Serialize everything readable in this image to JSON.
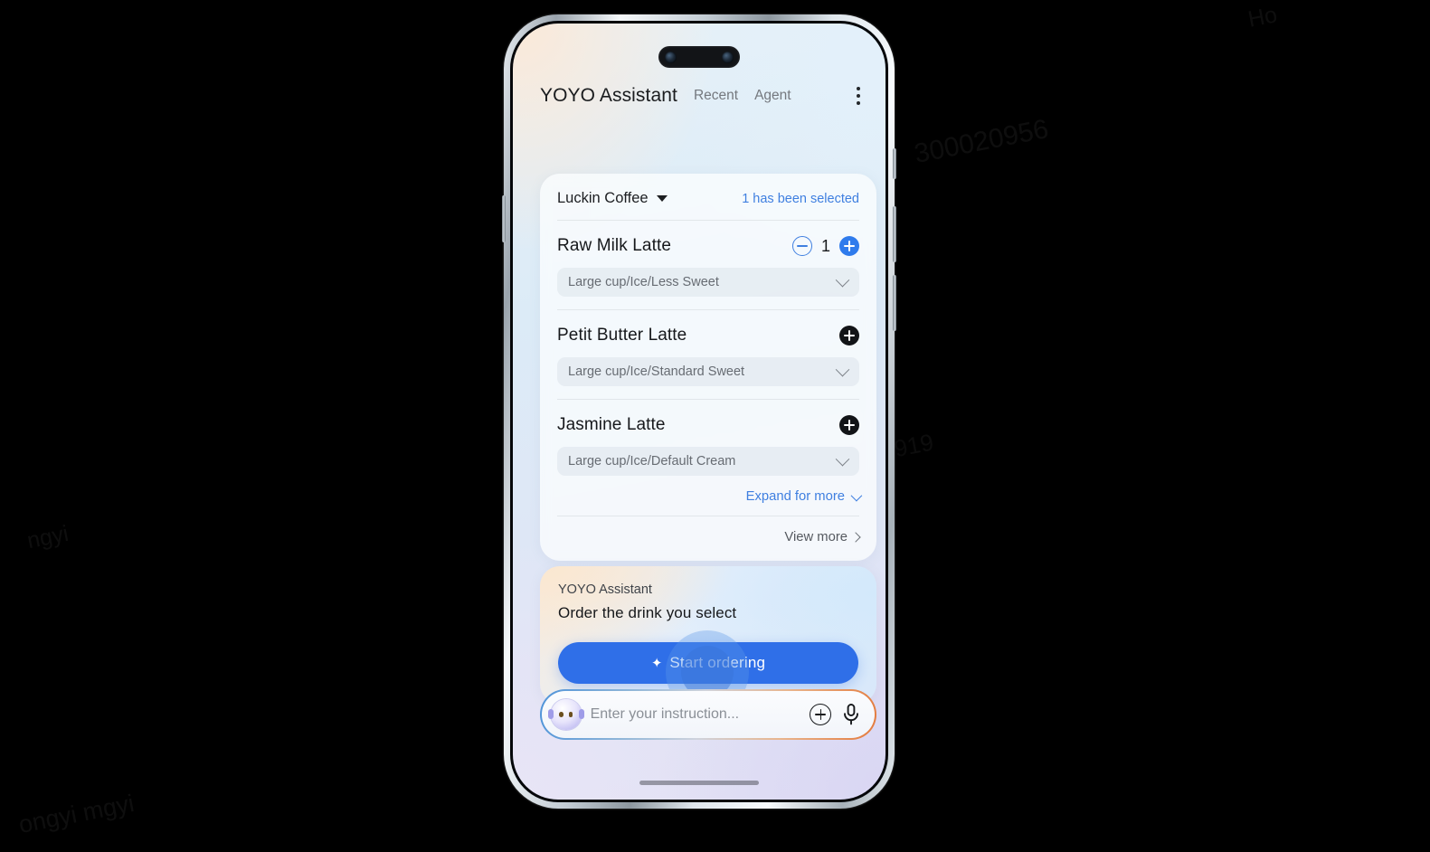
{
  "watermarks": [
    "300020956",
    "n",
    "00020956",
    "00020956",
    "ng919",
    "ongyi mgyi",
    "ngyi",
    "Ho",
    "ong"
  ],
  "header": {
    "title": "YOYO Assistant",
    "tabs": [
      {
        "label": "Recent"
      },
      {
        "label": "Agent"
      }
    ],
    "more_icon": "more-vertical-icon"
  },
  "drinks_card": {
    "shop_name": "Luckin Coffee",
    "shop_caret_icon": "caret-down-icon",
    "selected_count": "1 has been selected",
    "items": [
      {
        "name": "Raw Milk Latte",
        "options": "Large cup/Ice/Less Sweet",
        "quantity": "1",
        "has_stepper": true,
        "minus_icon": "minus-circle-icon",
        "plus_icon": "plus-circle-filled-icon",
        "chevron_icon": "chevron-down-icon"
      },
      {
        "name": "Petit Butter Latte",
        "options": "Large cup/Ice/Standard Sweet",
        "quantity": "",
        "has_stepper": false,
        "plus_icon": "plus-circle-dark-icon",
        "chevron_icon": "chevron-down-icon"
      },
      {
        "name": "Jasmine Latte",
        "options": "Large cup/Ice/Default Cream",
        "quantity": "",
        "has_stepper": false,
        "plus_icon": "plus-circle-dark-icon",
        "chevron_icon": "chevron-down-icon"
      }
    ],
    "expand_label": "Expand for more",
    "expand_icon": "chevron-down-icon",
    "view_more_label": "View more",
    "view_more_icon": "chevron-right-icon"
  },
  "assistant": {
    "name": "YOYO Assistant",
    "message": "Order the drink you select",
    "cta_label": "Start ordering",
    "cta_icon": "sparkle-icon",
    "sparkle_glyph": "✦"
  },
  "input_bar": {
    "avatar_icon": "bot-avatar-icon",
    "placeholder": "Enter your instruction...",
    "value": "",
    "add_icon": "plus-circle-icon",
    "mic_icon": "microphone-icon"
  },
  "colors": {
    "accent_blue": "#3f7fe0",
    "cta_blue": "#2f6fe8",
    "dark": "#16181b",
    "muted": "#676c73"
  }
}
